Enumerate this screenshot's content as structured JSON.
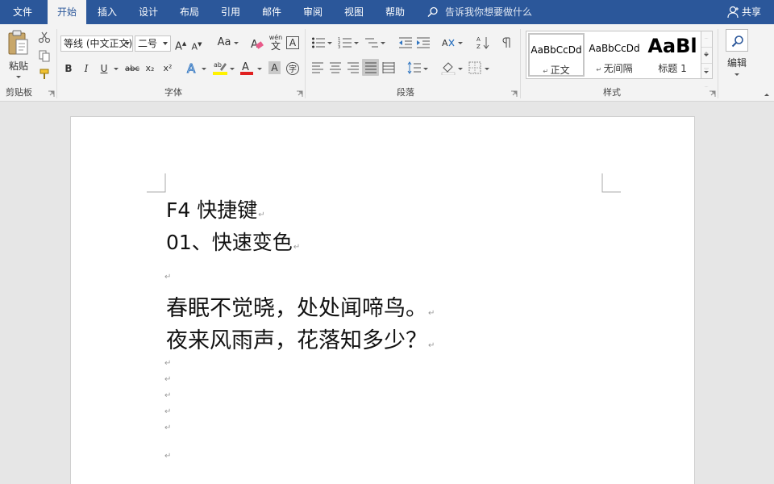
{
  "menu": {
    "tabs": [
      "文件",
      "开始",
      "插入",
      "设计",
      "布局",
      "引用",
      "邮件",
      "审阅",
      "视图",
      "帮助"
    ],
    "active_tab": "开始",
    "tellme_placeholder": "告诉我你想要做什么",
    "share_label": "共享"
  },
  "ribbon": {
    "clipboard": {
      "paste_label": "粘贴",
      "group_label": "剪贴板"
    },
    "font": {
      "font_name": "等线 (中文正文)",
      "font_size": "二号",
      "grow_label": "A",
      "shrink_label": "A",
      "case_label": "Aa",
      "phonetic_label": "wén",
      "bold": "B",
      "italic": "I",
      "underline": "U",
      "strike": "abc",
      "subscript": "x₂",
      "superscript": "x²",
      "group_label": "字体"
    },
    "paragraph": {
      "group_label": "段落"
    },
    "styles": {
      "items": [
        {
          "sample": "AaBbCcDd",
          "name": "正文"
        },
        {
          "sample": "AaBbCcDd",
          "name": "无间隔"
        },
        {
          "sample": "AaBl",
          "name": "标题 1"
        }
      ],
      "group_label": "样式"
    },
    "editing": {
      "label": "编辑"
    }
  },
  "document": {
    "paragraphs": [
      {
        "text": "F4 快捷键",
        "size": "small"
      },
      {
        "text": "01、快速变色",
        "size": "small"
      },
      {
        "text": "",
        "size": "tiny"
      },
      {
        "text": "春眠不觉晓，处处闻啼鸟。",
        "size": "large"
      },
      {
        "text": "夜来风雨声，花落知多少？",
        "size": "large"
      },
      {
        "text": "",
        "size": "tiny"
      },
      {
        "text": "",
        "size": "tiny"
      },
      {
        "text": "",
        "size": "tiny"
      },
      {
        "text": "",
        "size": "tiny"
      },
      {
        "text": "",
        "size": "tiny"
      },
      {
        "text": "",
        "size": "tiny"
      }
    ],
    "paragraph_mark": "↵"
  },
  "colors": {
    "brand": "#2b579a",
    "ribbon_bg": "#f3f3f3",
    "canvas_bg": "#e6e6e6",
    "font_color_red": "#e02020",
    "highlight_yellow": "#fff200"
  }
}
